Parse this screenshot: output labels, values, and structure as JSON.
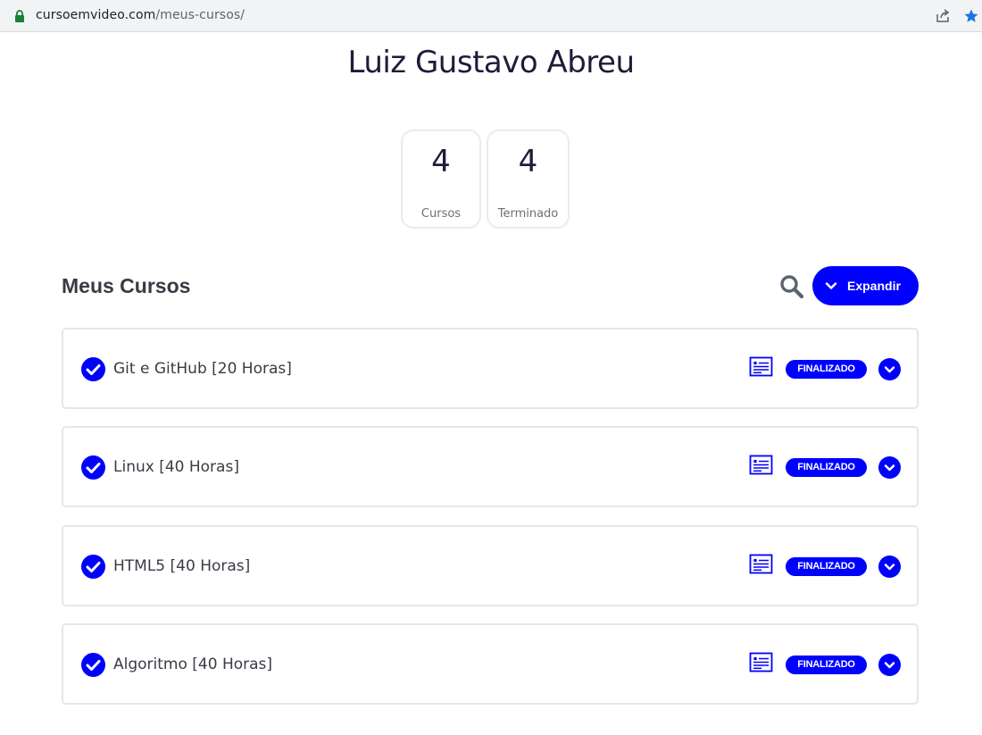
{
  "browser": {
    "url_host": "cursoemvideo.com",
    "url_path": "/meus-cursos/"
  },
  "profile": {
    "name": "Luiz Gustavo Abreu"
  },
  "stats": [
    {
      "value": "4",
      "label": "Cursos"
    },
    {
      "value": "4",
      "label": "Terminado"
    }
  ],
  "section": {
    "title": "Meus Cursos",
    "expand_label": "Expandir"
  },
  "courses": [
    {
      "title": "Git e GitHub [20 Horas]",
      "status": "FINALIZADO"
    },
    {
      "title": "Linux [40 Horas]",
      "status": "FINALIZADO"
    },
    {
      "title": "HTML5 [40 Horas]",
      "status": "FINALIZADO"
    },
    {
      "title": "Algoritmo [40 Horas]",
      "status": "FINALIZADO"
    }
  ],
  "icons": {
    "lock": "lock-icon",
    "share": "share-icon",
    "star": "star-icon",
    "search": "search-icon",
    "chevron": "chevron-down-icon",
    "check": "check-circle-icon",
    "certificate": "certificate-icon"
  },
  "colors": {
    "accent": "#0000ff",
    "title_text": "#1e1b3a",
    "card_border": "#e6e6ea",
    "star": "#1a73e8",
    "lock": "#188038"
  }
}
